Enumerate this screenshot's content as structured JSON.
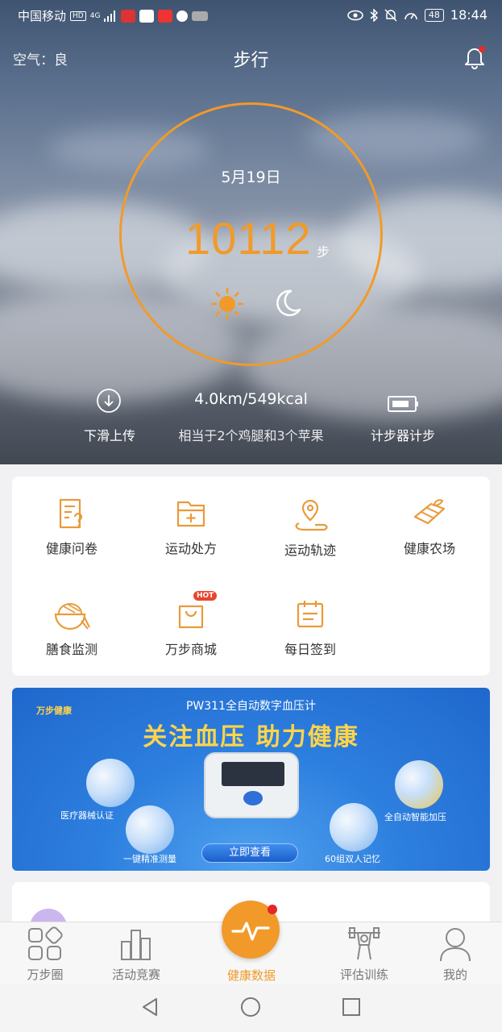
{
  "status_bar": {
    "carrier": "中国移动",
    "hd": "HD",
    "net": "4G",
    "battery": "48",
    "time": "18:44"
  },
  "header": {
    "air_quality": "空气：良",
    "title": "步行"
  },
  "ring": {
    "date": "5月19日",
    "steps": "10112",
    "steps_unit": "步"
  },
  "stats": {
    "upload_label": "下滑上传",
    "distance_calories": "4.0km/549kcal",
    "equivalent": "相当于2个鸡腿和3个苹果",
    "pedometer_label": "计步器计步"
  },
  "grid": {
    "items": [
      {
        "label": "健康问卷",
        "icon": "questionnaire-icon"
      },
      {
        "label": "运动处方",
        "icon": "prescription-icon"
      },
      {
        "label": "运动轨迹",
        "icon": "track-icon"
      },
      {
        "label": "健康农场",
        "icon": "farm-icon"
      },
      {
        "label": "膳食监测",
        "icon": "diet-icon"
      },
      {
        "label": "万步商城",
        "icon": "shop-icon"
      },
      {
        "label": "每日签到",
        "icon": "checkin-icon"
      }
    ],
    "hot_badge": "HOT"
  },
  "banner": {
    "subtitle": "PW311全自动数字血压计",
    "title": "关注血压  助力健康",
    "logo_text": "万步健康",
    "feature_1": "医疗器械认证",
    "feature_2": "一键精准测量",
    "feature_3": "全自动智能加压",
    "feature_4": "60组双人记忆",
    "cta": "立即查看"
  },
  "tabbar": {
    "items": [
      {
        "label": "万步圈"
      },
      {
        "label": "活动竞赛"
      },
      {
        "label": "健康数据"
      },
      {
        "label": "评估训练"
      },
      {
        "label": "我的"
      }
    ]
  },
  "colors": {
    "accent": "#f19a2a",
    "badge": "#e5262a"
  }
}
